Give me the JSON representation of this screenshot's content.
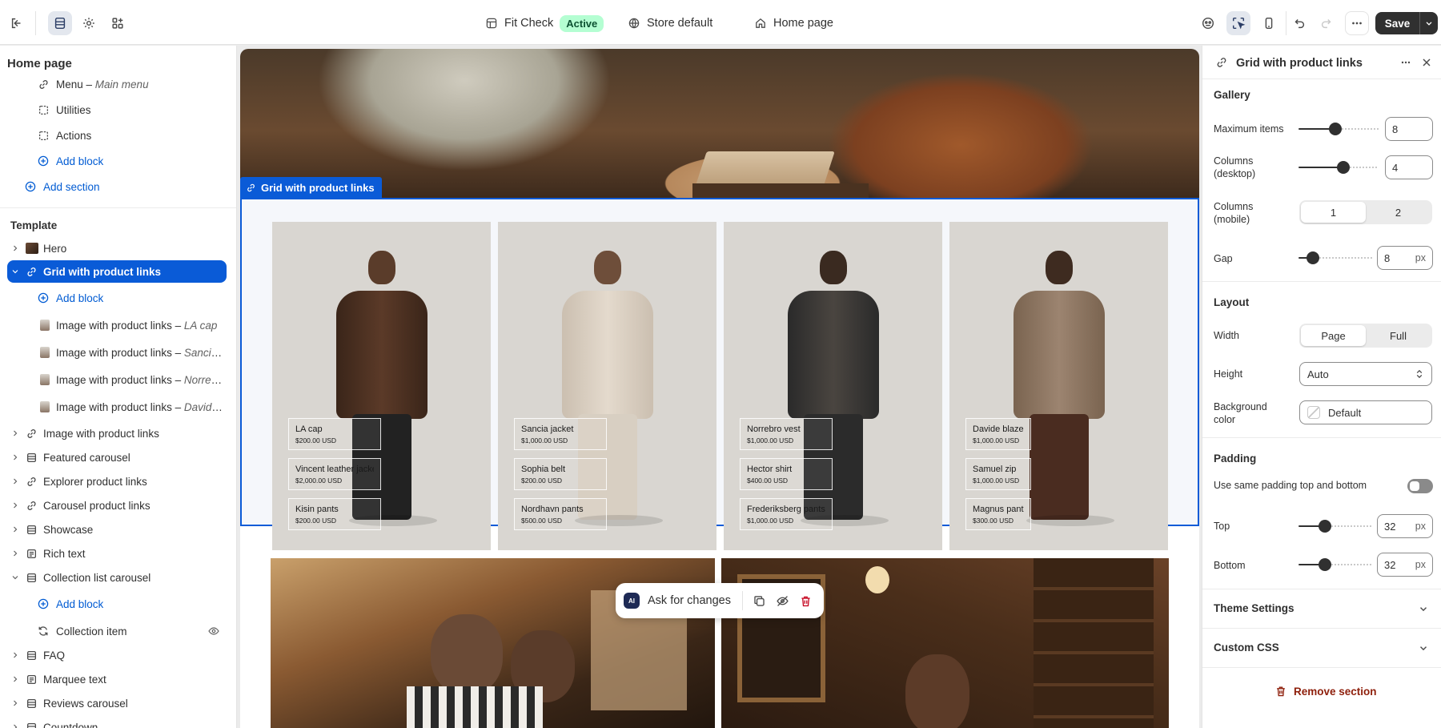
{
  "topbar": {
    "theme_name": "Fit Check",
    "theme_status": "Active",
    "store": "Store default",
    "page": "Home page",
    "save_label": "Save"
  },
  "left": {
    "title": "Home page",
    "header_blocks": [
      {
        "label": "Menu",
        "sub": "Main menu",
        "icon": "link-icon"
      },
      {
        "label": "Utilities",
        "sub": "",
        "icon": "block-icon"
      },
      {
        "label": "Actions",
        "sub": "",
        "icon": "block-icon"
      }
    ],
    "add_block": "Add block",
    "add_section": "Add section",
    "template_label": "Template",
    "sections": [
      {
        "label": "Hero"
      },
      {
        "label": "Grid with product links"
      },
      {
        "label": "Image with product links"
      },
      {
        "label": "Featured carousel"
      },
      {
        "label": "Explorer product links"
      },
      {
        "label": "Carousel product links"
      },
      {
        "label": "Showcase"
      },
      {
        "label": "Rich text"
      },
      {
        "label": "Collection list carousel"
      },
      {
        "label": "FAQ"
      },
      {
        "label": "Marquee text"
      },
      {
        "label": "Reviews carousel"
      },
      {
        "label": "Countdown"
      }
    ],
    "grid_children": [
      {
        "label": "Image with product links",
        "sub": "LA cap"
      },
      {
        "label": "Image with product links",
        "sub": "Sancia jacket"
      },
      {
        "label": "Image with product links",
        "sub": "Norrebro vest"
      },
      {
        "label": "Image with product links",
        "sub": "Davide blazer"
      }
    ],
    "collection_item": "Collection item"
  },
  "canvas": {
    "selected_tag": "Grid with product links",
    "cards": [
      {
        "products": [
          {
            "name": "LA cap",
            "price": "$200.00 USD"
          },
          {
            "name": "Vincent leather jacket",
            "price": "$2,000.00 USD"
          },
          {
            "name": "Kisin pants",
            "price": "$200.00 USD"
          }
        ]
      },
      {
        "products": [
          {
            "name": "Sancia jacket",
            "price": "$1,000.00 USD"
          },
          {
            "name": "Sophia belt",
            "price": "$200.00 USD"
          },
          {
            "name": "Nordhavn pants",
            "price": "$500.00 USD"
          }
        ]
      },
      {
        "products": [
          {
            "name": "Norrebro vest",
            "price": "$1,000.00 USD"
          },
          {
            "name": "Hector shirt",
            "price": "$400.00 USD"
          },
          {
            "name": "Frederiksberg pants",
            "price": "$1,000.00 USD"
          }
        ]
      },
      {
        "products": [
          {
            "name": "Davide blazer",
            "price": "$1,000.00 USD"
          },
          {
            "name": "Samuel zip",
            "price": "$1,000.00 USD"
          },
          {
            "name": "Magnus pants",
            "price": "$300.00 USD"
          }
        ]
      }
    ],
    "ask_label": "Ask for changes",
    "ai_badge": "AI"
  },
  "right": {
    "title": "Grid with product links",
    "gallery_label": "Gallery",
    "max_items_label": "Maximum items",
    "max_items_value": "8",
    "max_items_level": 0.45,
    "cols_desktop_label": "Columns (desktop)",
    "cols_desktop_value": "4",
    "cols_desktop_level": 0.57,
    "cols_mobile_label": "Columns (mobile)",
    "cols_mobile_options": [
      "1",
      "2"
    ],
    "gap_label": "Gap",
    "gap_value": "8",
    "gap_level": 0.13,
    "unit_px": "px",
    "layout_label": "Layout",
    "width_label": "Width",
    "width_options": [
      "Page",
      "Full"
    ],
    "height_label": "Height",
    "height_value": "Auto",
    "bg_label": "Background color",
    "bg_value": "Default",
    "padding_label": "Padding",
    "same_padding_label": "Use same padding top and bottom",
    "top_label": "Top",
    "top_value": "32",
    "top_level": 0.33,
    "bottom_label": "Bottom",
    "bottom_value": "32",
    "bottom_level": 0.33,
    "theme_settings": "Theme Settings",
    "custom_css": "Custom CSS",
    "remove_section": "Remove section"
  }
}
